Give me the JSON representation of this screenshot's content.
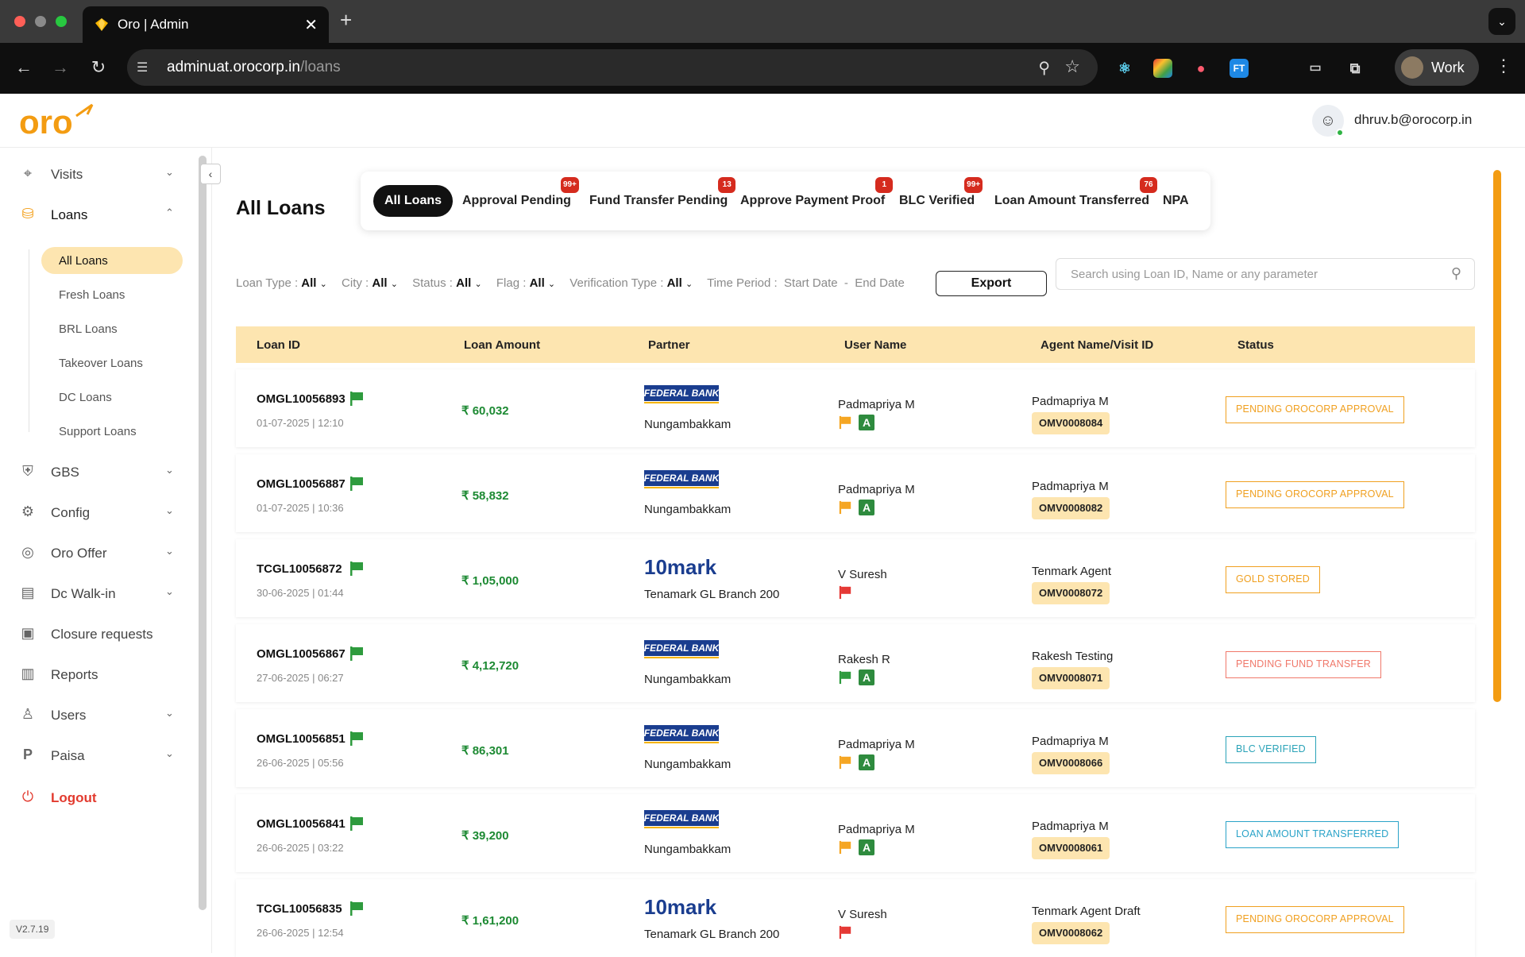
{
  "browser": {
    "tab_title": "Oro | Admin",
    "url_host": "adminuat.orocorp.in",
    "url_path": "/loans",
    "profile_label": "Work"
  },
  "header": {
    "logo_text": "oro",
    "user_email": "dhruv.b@orocorp.in"
  },
  "sidebar": {
    "items": [
      {
        "label": "Visits",
        "icon": "location-pin-icon"
      },
      {
        "label": "Loans",
        "icon": "gold-coins-icon"
      },
      {
        "label": "GBS",
        "icon": "gbs-icon"
      },
      {
        "label": "Config",
        "icon": "gear-icon"
      },
      {
        "label": "Oro Offer",
        "icon": "offer-icon"
      },
      {
        "label": "Dc Walk-in",
        "icon": "walkin-icon"
      },
      {
        "label": "Closure requests",
        "icon": "archive-icon"
      },
      {
        "label": "Reports",
        "icon": "bar-chart-icon"
      },
      {
        "label": "Users",
        "icon": "user-icon"
      },
      {
        "label": "Paisa",
        "icon": "paisa-icon"
      },
      {
        "label": "Logout",
        "icon": "logout-icon"
      }
    ],
    "loan_subitems": [
      "All Loans",
      "Fresh Loans",
      "BRL Loans",
      "Takeover Loans",
      "DC Loans",
      "Support Loans"
    ],
    "version": "V2.7.19"
  },
  "main": {
    "title": "All Loans",
    "tabs": [
      {
        "label": "All Loans",
        "badge": ""
      },
      {
        "label": "Approval Pending",
        "badge": "99+"
      },
      {
        "label": "Fund Transfer Pending",
        "badge": "13"
      },
      {
        "label": "Approve Payment Proof",
        "badge": "1"
      },
      {
        "label": "BLC Verified",
        "badge": "99+"
      },
      {
        "label": "Loan Amount Transferred",
        "badge": "76"
      },
      {
        "label": "NPA",
        "badge": ""
      }
    ],
    "filters": {
      "loan_type_label": "Loan Type :",
      "loan_type_value": "All",
      "city_label": "City :",
      "city_value": "All",
      "status_label": "Status :",
      "status_value": "All",
      "flag_label": "Flag :",
      "flag_value": "All",
      "verification_label": "Verification Type :",
      "verification_value": "All",
      "time_period_label": "Time Period :",
      "start_date": "Start Date",
      "separator": "-",
      "end_date": "End Date"
    },
    "export_label": "Export",
    "search_placeholder": "Search using Loan ID, Name or any parameter",
    "columns": [
      "Loan ID",
      "Loan Amount",
      "Partner",
      "User Name",
      "Agent Name/Visit ID",
      "Status"
    ],
    "rows": [
      {
        "loan_id": "OMGL10056893",
        "date": "01-07-2025 | 12:10",
        "amount": "₹ 60,032",
        "partner": "FEDERAL BANK",
        "location": "Nungambakkam",
        "user": "Padmapriya M",
        "user_flag": "orange",
        "user_badge": "A",
        "agent": "Padmapriya M",
        "visit_id": "OMV0008084",
        "status": "PENDING OROCORP APPROVAL",
        "status_color": "#f0a020"
      },
      {
        "loan_id": "OMGL10056887",
        "date": "01-07-2025 | 10:36",
        "amount": "₹ 58,832",
        "partner": "FEDERAL BANK",
        "location": "Nungambakkam",
        "user": "Padmapriya M",
        "user_flag": "orange",
        "user_badge": "A",
        "agent": "Padmapriya M",
        "visit_id": "OMV0008082",
        "status": "PENDING OROCORP APPROVAL",
        "status_color": "#f0a020"
      },
      {
        "loan_id": "TCGL10056872",
        "date": "30-06-2025 | 01:44",
        "amount": "₹ 1,05,000",
        "partner": "10mark",
        "location": "Tenamark GL Branch 200",
        "user": "V Suresh",
        "user_flag": "red",
        "user_badge": "",
        "agent": "Tenmark Agent",
        "visit_id": "OMV0008072",
        "status": "GOLD STORED",
        "status_color": "#f0a020"
      },
      {
        "loan_id": "OMGL10056867",
        "date": "27-06-2025 | 06:27",
        "amount": "₹ 4,12,720",
        "partner": "FEDERAL BANK",
        "location": "Nungambakkam",
        "user": "Rakesh R",
        "user_flag": "green",
        "user_badge": "A",
        "agent": "Rakesh Testing",
        "visit_id": "OMV0008071",
        "status": "PENDING FUND TRANSFER",
        "status_color": "#f0786a"
      },
      {
        "loan_id": "OMGL10056851",
        "date": "26-06-2025 | 05:56",
        "amount": "₹ 86,301",
        "partner": "FEDERAL BANK",
        "location": "Nungambakkam",
        "user": "Padmapriya M",
        "user_flag": "orange",
        "user_badge": "A",
        "agent": "Padmapriya M",
        "visit_id": "OMV0008066",
        "status": "BLC VERIFIED",
        "status_color": "#2aa3b8"
      },
      {
        "loan_id": "OMGL10056841",
        "date": "26-06-2025 | 03:22",
        "amount": "₹ 39,200",
        "partner": "FEDERAL BANK",
        "location": "Nungambakkam",
        "user": "Padmapriya M",
        "user_flag": "orange",
        "user_badge": "A",
        "agent": "Padmapriya M",
        "visit_id": "OMV0008061",
        "status": "LOAN AMOUNT TRANSFERRED",
        "status_color": "#2aa3c8"
      },
      {
        "loan_id": "TCGL10056835",
        "date": "26-06-2025 | 12:54",
        "amount": "₹ 1,61,200",
        "partner": "10mark",
        "location": "Tenamark GL Branch 200",
        "user": "V Suresh",
        "user_flag": "red",
        "user_badge": "",
        "agent": "Tenmark Agent Draft",
        "visit_id": "OMV0008062",
        "status": "PENDING OROCORP APPROVAL",
        "status_color": "#f0a020"
      }
    ],
    "colors": {
      "accent": "#f39c12",
      "header_row": "#fde5b0",
      "amount": "#1d8a33",
      "row_flag": "#2e9b3e"
    }
  }
}
